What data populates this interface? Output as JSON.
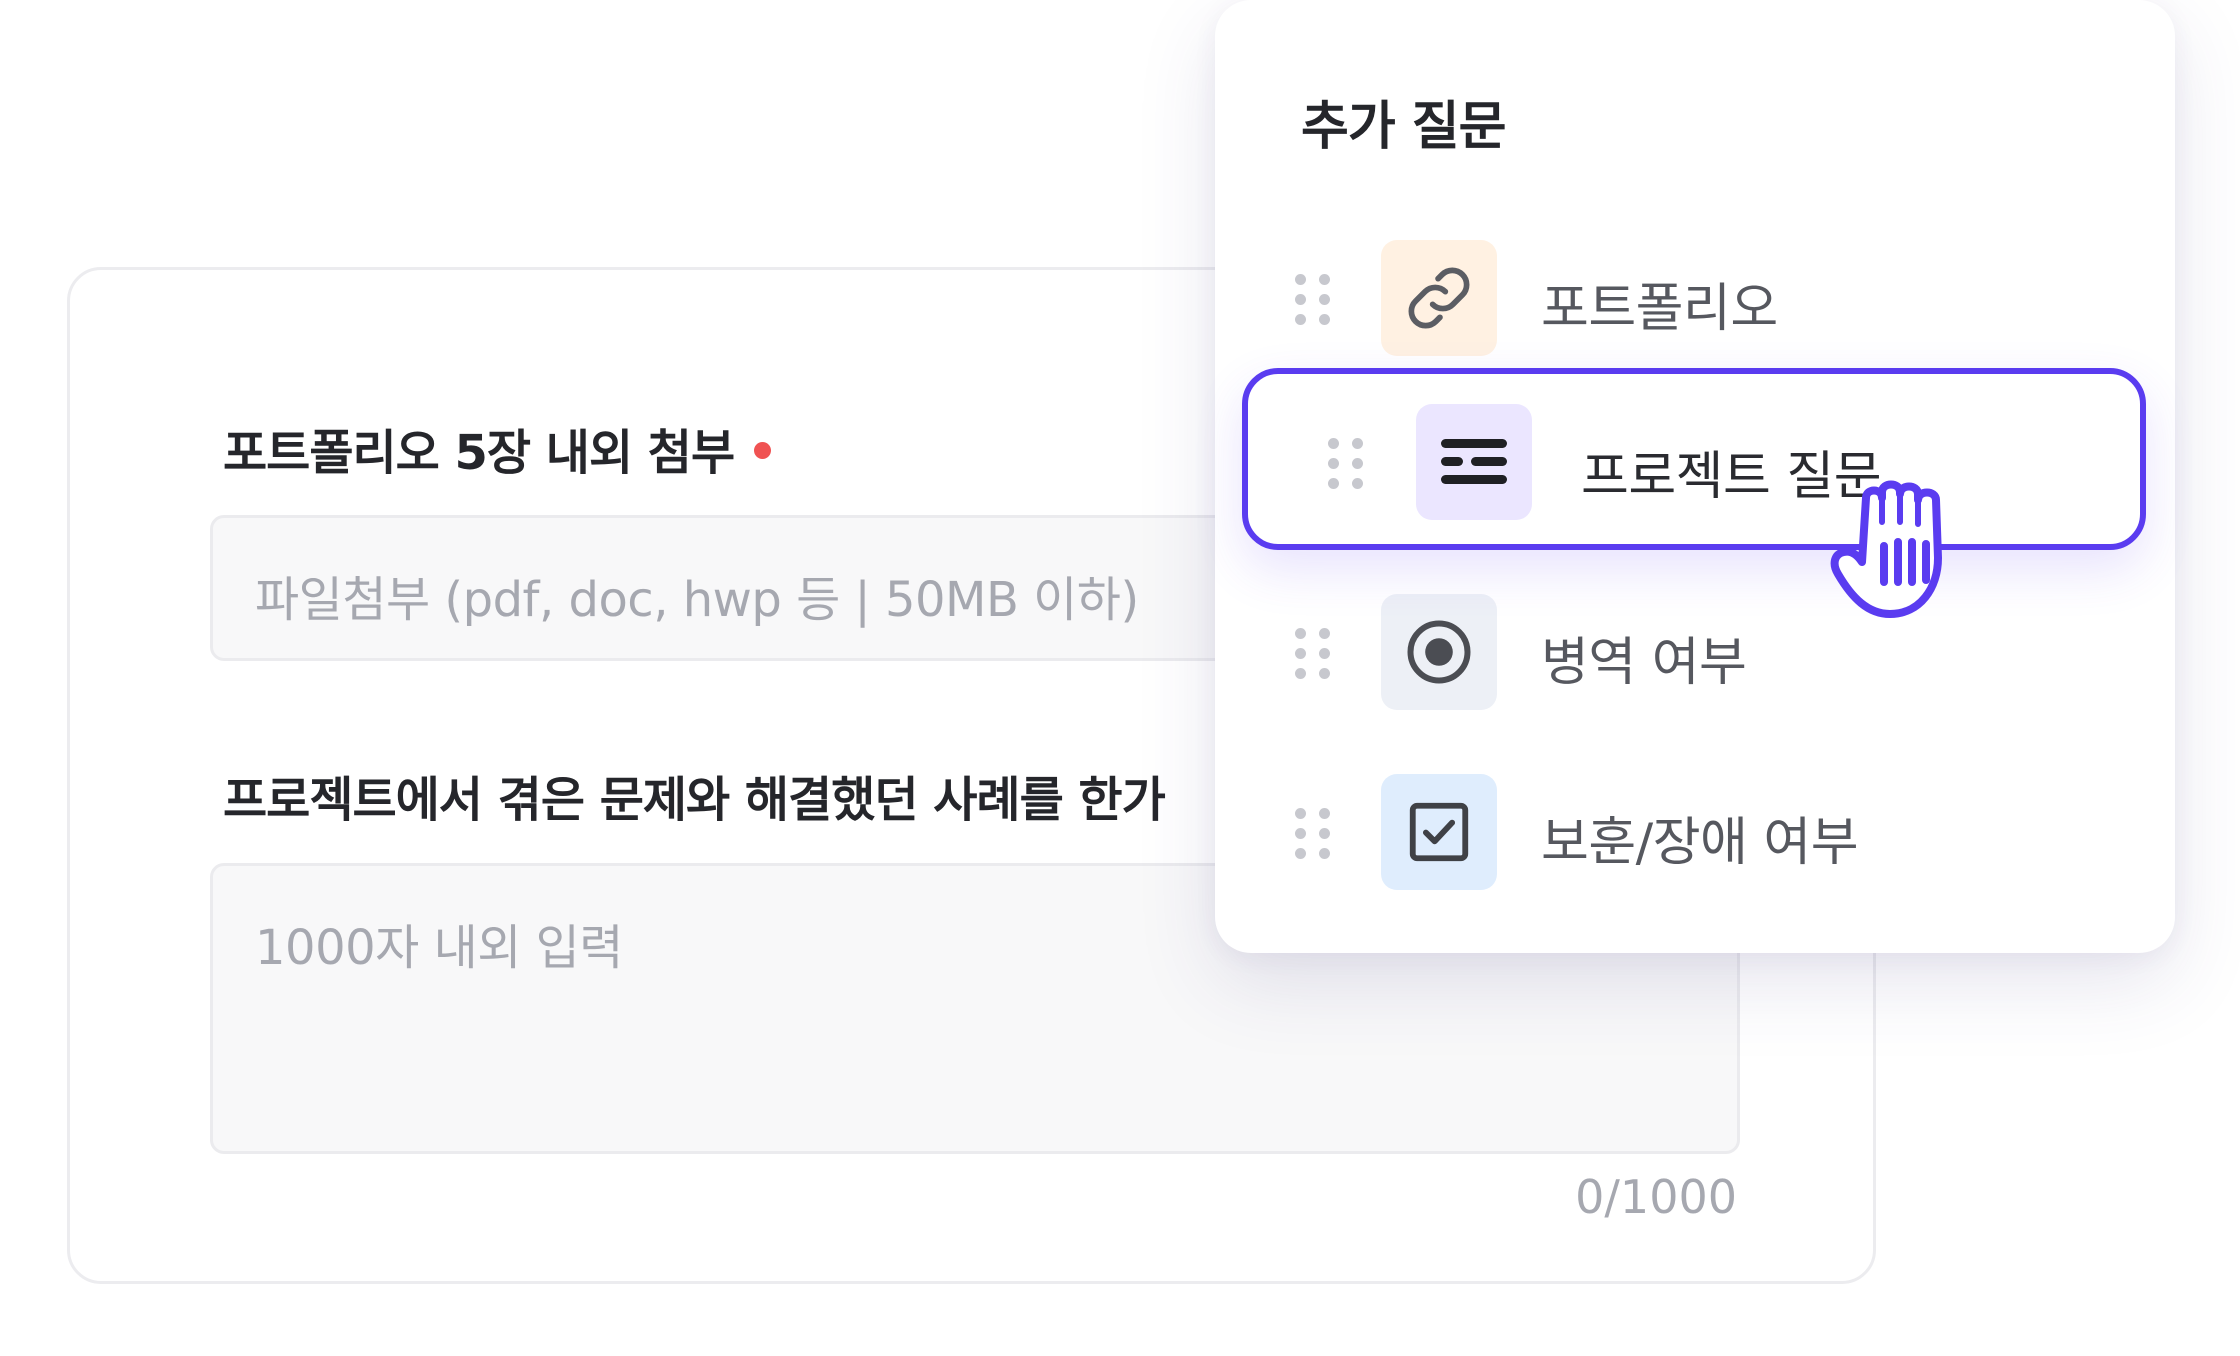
{
  "form": {
    "question1": {
      "label": "포트폴리오 5장 내외 첨부",
      "required": true,
      "placeholder": "파일첨부 (pdf, doc, hwp 등 | 50MB 이하)"
    },
    "question2": {
      "label": "프로젝트에서 겪은 문제와 해결했던 사례를 한가",
      "placeholder": "1000자 내외 입력",
      "char_count": "0/1000"
    }
  },
  "popover": {
    "title": "추가 질문",
    "items": [
      {
        "label": "포트폴리오",
        "icon": "link-icon",
        "icon_bg": "#fff1e2"
      },
      {
        "label": "프로젝트 질문",
        "icon": "text-lines-icon",
        "icon_bg": "#ebe6ff",
        "dragging": true
      },
      {
        "label": "병역 여부",
        "icon": "radio-icon",
        "icon_bg": "#edf0f6"
      },
      {
        "label": "보훈/장애 여부",
        "icon": "checkbox-icon",
        "icon_bg": "#dfedfd"
      }
    ]
  },
  "colors": {
    "accent": "#5a3cf0",
    "required_dot": "#f05252",
    "placeholder_text": "#a6a8b0"
  }
}
